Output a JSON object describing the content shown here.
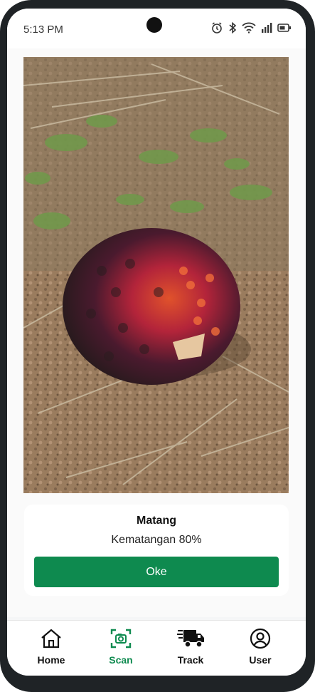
{
  "status": {
    "time": "5:13 PM",
    "icons": [
      "alarm-icon",
      "bluetooth-icon",
      "wifi-icon",
      "signal-icon",
      "battery-icon"
    ]
  },
  "photo": {
    "subject": "oil-palm-fruit-bunch-photo"
  },
  "result": {
    "title": "Matang",
    "subtitle": "Kematangan 80%",
    "button_label": "Oke"
  },
  "nav": {
    "items": [
      {
        "label": "Home",
        "icon": "home-icon"
      },
      {
        "label": "Scan",
        "icon": "scan-icon",
        "active": true
      },
      {
        "label": "Track",
        "icon": "truck-icon"
      },
      {
        "label": "User",
        "icon": "user-icon"
      }
    ]
  },
  "colors": {
    "accent": "#0e8a4f",
    "frame": "#1f2326"
  }
}
